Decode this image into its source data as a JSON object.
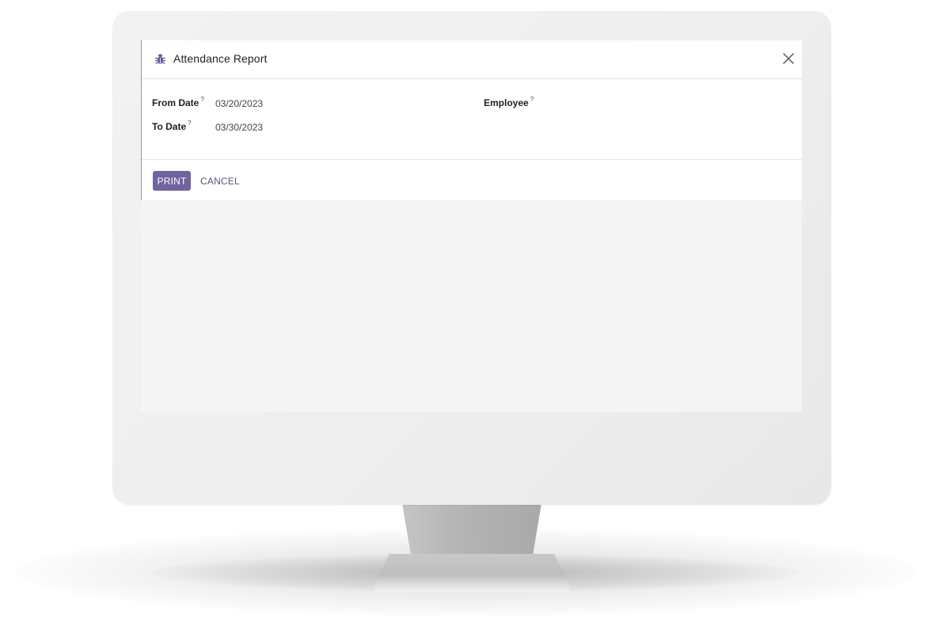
{
  "dialog": {
    "title": "Attendance Report",
    "title_icon": "bug-icon",
    "close_icon": "close-icon",
    "accent_color": "#71639e"
  },
  "form": {
    "from_date": {
      "label": "From Date",
      "help": "?",
      "value": "03/20/2023"
    },
    "to_date": {
      "label": "To Date",
      "help": "?",
      "value": "03/30/2023"
    },
    "employee": {
      "label": "Employee",
      "help": "?",
      "value": ""
    }
  },
  "footer": {
    "print_label": "PRINT",
    "cancel_label": "CANCEL"
  }
}
